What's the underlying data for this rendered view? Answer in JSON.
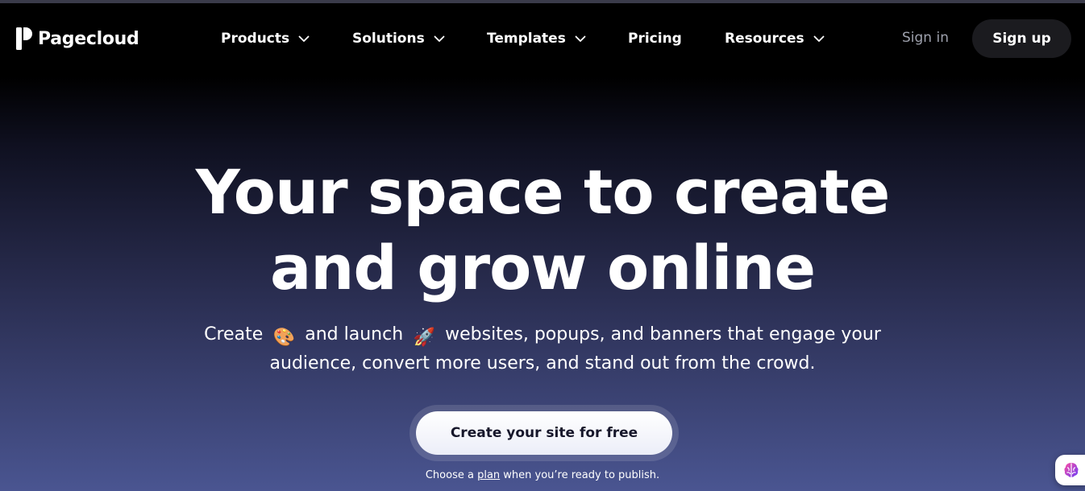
{
  "brand": {
    "name": "Pagecloud",
    "logo_icon": "pagecloud-logo-icon"
  },
  "nav": {
    "items": [
      {
        "label": "Products",
        "has_dropdown": true
      },
      {
        "label": "Solutions",
        "has_dropdown": true
      },
      {
        "label": "Templates",
        "has_dropdown": true
      },
      {
        "label": "Pricing",
        "has_dropdown": false
      },
      {
        "label": "Resources",
        "has_dropdown": true
      }
    ],
    "sign_in": "Sign in",
    "sign_up": "Sign up"
  },
  "hero": {
    "title_line1": "Your space to create",
    "title_line2": "and grow online",
    "subtitle_part1": "Create",
    "subtitle_emoji1": "🎨",
    "subtitle_part2": "and launch",
    "subtitle_emoji2": "🚀",
    "subtitle_part3": "websites, popups, and banners that engage your",
    "subtitle_line2": "audience, convert more users, and stand out from the crowd.",
    "cta_label": "Create your site for free",
    "note_before": "Choose a",
    "note_link": "plan",
    "note_after": "when you’re ready to publish."
  },
  "widget": {
    "icon": "brain-icon"
  },
  "colors": {
    "background_top": "#000000",
    "background_bottom": "#4a5591",
    "sign_in_text": "#9ea1ad",
    "sign_up_bg": "#1b1b1f",
    "cta_bg": "#ffffff",
    "cta_text": "#17172b"
  }
}
